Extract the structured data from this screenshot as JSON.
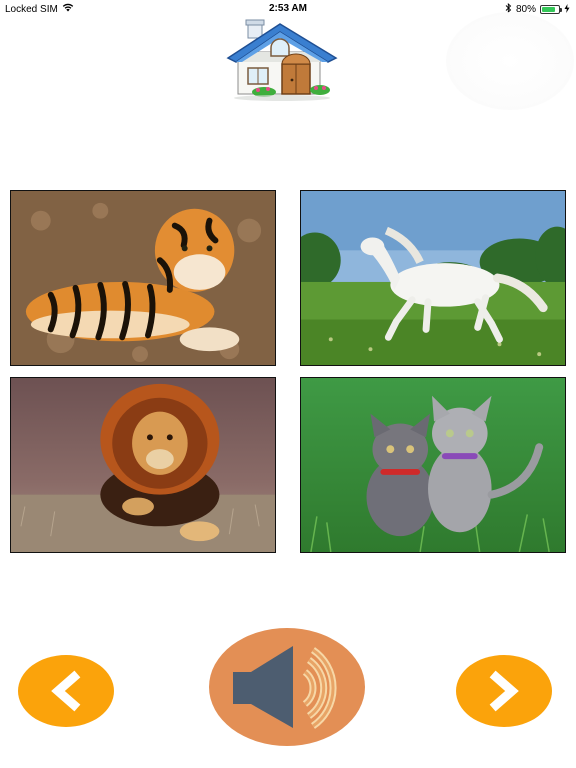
{
  "status_bar": {
    "carrier": "Locked SIM",
    "time": "2:53 AM",
    "battery_percent": "80%",
    "battery_level": 0.8,
    "wifi_icon": "wifi-icon",
    "bluetooth_icon": "bluetooth-icon",
    "charging_icon": "bolt-icon"
  },
  "header": {
    "home_icon": "house-icon"
  },
  "grid": {
    "cards": [
      {
        "animal": "tiger"
      },
      {
        "animal": "horse"
      },
      {
        "animal": "lion"
      },
      {
        "animal": "kittens"
      }
    ]
  },
  "controls": {
    "prev_icon": "chevron-left-icon",
    "sound_icon": "speaker-icon",
    "next_icon": "chevron-right-icon",
    "accent_orange": "#fba30b",
    "speaker_bg": "#e38f55"
  }
}
